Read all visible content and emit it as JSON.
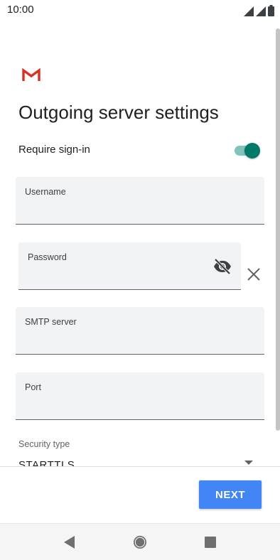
{
  "status_bar": {
    "time": "10:00",
    "icons": [
      "signal-icon",
      "signal-icon",
      "battery-icon"
    ]
  },
  "app": {
    "logo_icon": "gmail-logo-icon"
  },
  "page": {
    "title": "Outgoing server settings"
  },
  "require_signin": {
    "label": "Require sign-in",
    "enabled": true
  },
  "fields": {
    "username": {
      "label": "Username",
      "value": ""
    },
    "password": {
      "label": "Password",
      "value": "",
      "toggle_icon": "visibility-off-icon",
      "clear_icon": "close-icon"
    },
    "smtp_server": {
      "label": "SMTP server",
      "value": ""
    },
    "port": {
      "label": "Port",
      "value": ""
    }
  },
  "security_type": {
    "label": "Security type",
    "value": "STARTTLS"
  },
  "actions": {
    "next_label": "NEXT"
  },
  "nav_bar": {
    "back_icon": "back-icon",
    "home_icon": "home-icon",
    "recents_icon": "recents-icon"
  },
  "colors": {
    "accent_teal": "#00796b",
    "primary_blue": "#4285f4",
    "field_bg": "#f1f3f4"
  }
}
